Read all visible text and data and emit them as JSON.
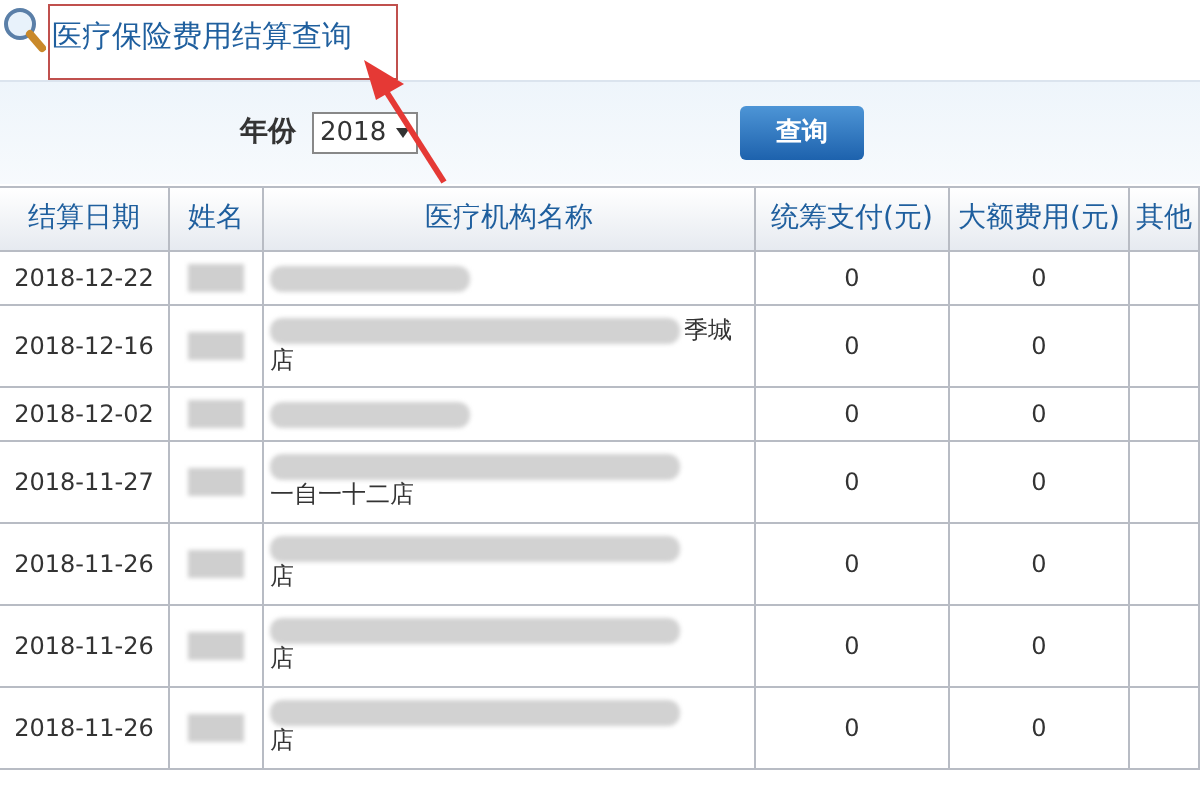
{
  "title": "医疗保险费用结算查询",
  "filter": {
    "label": "年份",
    "year": "2018",
    "button": "查询"
  },
  "table": {
    "columns": [
      "结算日期",
      "姓名",
      "医疗机构名称",
      "统筹支付(元)",
      "大额费用(元)",
      "其他"
    ],
    "rows": [
      {
        "date": "2018-12-22",
        "pooled": "0",
        "large": "0"
      },
      {
        "date": "2018-12-16",
        "institution_tail": "季城",
        "institution_line2": "店",
        "pooled": "0",
        "large": "0"
      },
      {
        "date": "2018-12-02",
        "pooled": "0",
        "large": "0"
      },
      {
        "date": "2018-11-27",
        "institution_line2": "一自一十二店",
        "pooled": "0",
        "large": "0"
      },
      {
        "date": "2018-11-26",
        "institution_line2": "店",
        "pooled": "0",
        "large": "0"
      },
      {
        "date": "2018-11-26",
        "institution_line2": "店",
        "pooled": "0",
        "large": "0"
      },
      {
        "date": "2018-11-26",
        "institution_line2": "店",
        "pooled": "0",
        "large": "0"
      }
    ]
  }
}
